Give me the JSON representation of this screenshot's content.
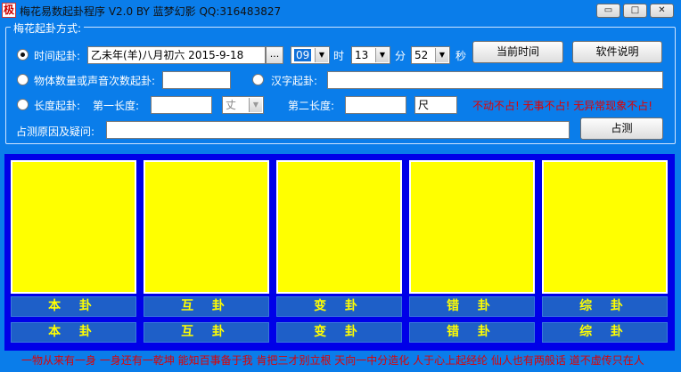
{
  "window": {
    "icon_glyph": "极",
    "title": "梅花易数起卦程序 V2.0   BY 蓝梦幻影 QQ:316483827",
    "controls": {
      "minimize": "▭",
      "maximize": "□",
      "close": "✕"
    }
  },
  "group": {
    "legend": "梅花起卦方式:",
    "time_method": {
      "label": "时间起卦:",
      "selected": true,
      "date_value": "乙未年(羊)八月初六 2015-9-18",
      "dots": "...",
      "hour": "09",
      "hour_unit": "时",
      "minute": "13",
      "minute_unit": "分",
      "second": "52",
      "second_unit": "秒"
    },
    "current_time_button": "当前时间",
    "help_button": "软件说明",
    "number_method": {
      "label": "物体数量或声音次数起卦:",
      "selected": false,
      "value": ""
    },
    "char_method": {
      "label": "汉字起卦:",
      "selected": false,
      "value": ""
    },
    "length_method": {
      "label": "长度起卦:",
      "selected": false,
      "first_label": "第一长度:",
      "first_value": "",
      "first_unit": "丈",
      "second_label": "第二长度:",
      "second_value": "",
      "second_unit": "尺"
    },
    "warning": "不动不占! 无事不占! 无异常现象不占!",
    "reason_label": "占测原因及疑问:",
    "reason_value": "",
    "divine_button": "占测"
  },
  "hexagrams": [
    {
      "name": "本 卦",
      "result": "本 卦"
    },
    {
      "name": "互 卦",
      "result": "互 卦"
    },
    {
      "name": "变 卦",
      "result": "变 卦"
    },
    {
      "name": "错 卦",
      "result": "错 卦"
    },
    {
      "name": "综 卦",
      "result": "综 卦"
    }
  ],
  "footer": "一物从来有一身  一身还有一乾坤  能知百事备于我  肯把三才别立根  天向一中分造化  人于心上起经纶  仙人也有两般话  道不虚传只在人",
  "colors": {
    "background": "#0a7dea",
    "board": "#0000e8",
    "card": "#ffff00",
    "accent_text": "#e00000"
  }
}
